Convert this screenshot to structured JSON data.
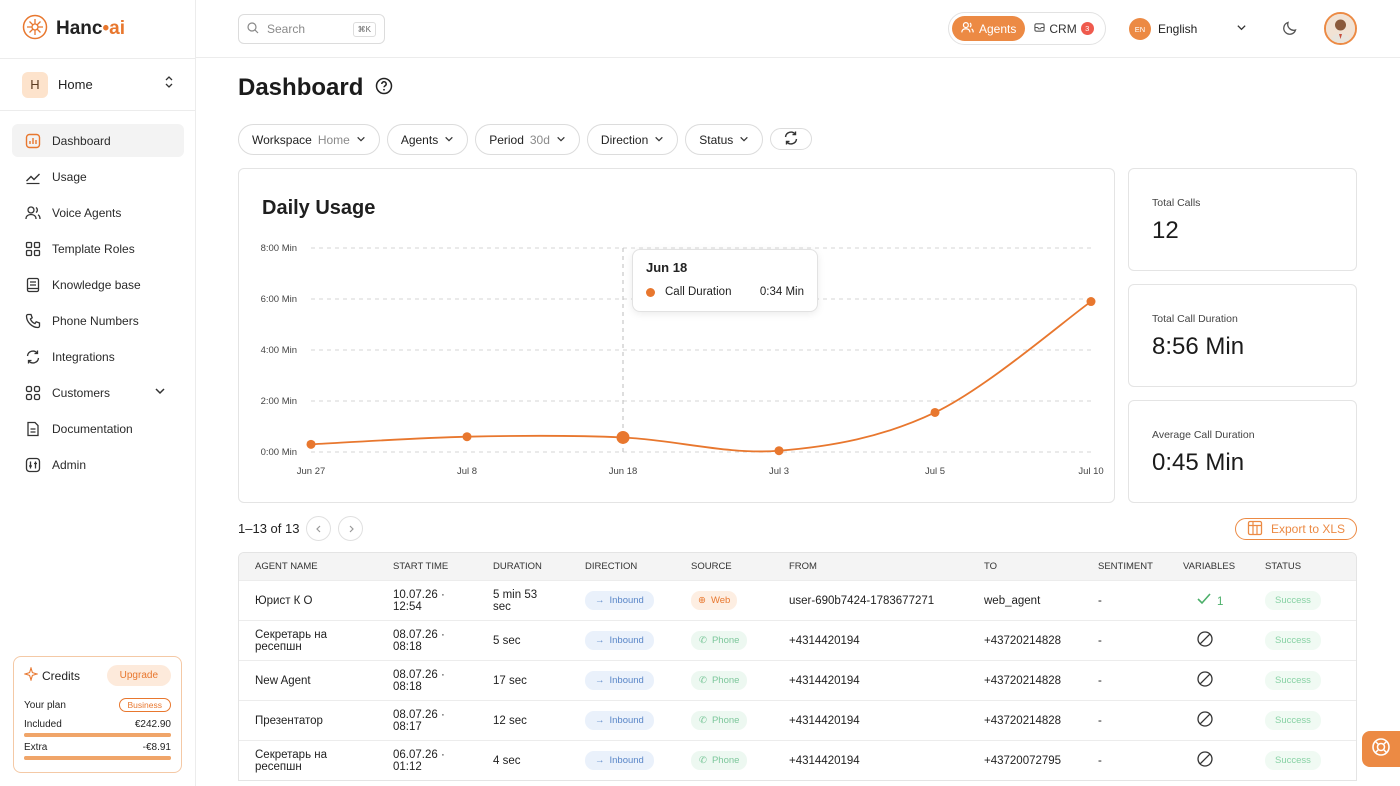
{
  "app": {
    "brand_a": "Hanc",
    "brand_dot": "•",
    "brand_b": "ai"
  },
  "workspace": {
    "initial": "H",
    "name": "Home"
  },
  "nav": [
    {
      "label": "Dashboard",
      "icon": "dashboard-icon",
      "active": true
    },
    {
      "label": "Usage",
      "icon": "trend-icon"
    },
    {
      "label": "Voice Agents",
      "icon": "users-icon"
    },
    {
      "label": "Template Roles",
      "icon": "grid-icon"
    },
    {
      "label": "Knowledge base",
      "icon": "book-icon"
    },
    {
      "label": "Phone Numbers",
      "icon": "phone-icon"
    },
    {
      "label": "Integrations",
      "icon": "sync-icon"
    },
    {
      "label": "Customers",
      "icon": "apps-icon"
    },
    {
      "label": "Documentation",
      "icon": "doc-icon"
    },
    {
      "label": "Admin",
      "icon": "admin-icon"
    }
  ],
  "credits": {
    "title": "Credits",
    "upgrade": "Upgrade",
    "plan_label": "Your plan",
    "plan": "Business",
    "included_label": "Included",
    "included": "€242.90",
    "included_fraction": 1.0,
    "extra_label": "Extra",
    "extra": "-€8.91",
    "extra_fraction": 1.0
  },
  "topbar": {
    "search_placeholder": "Search",
    "search_kbd": "⌘K",
    "agents": "Agents",
    "crm": "CRM",
    "crm_count": "3",
    "lang_code": "EN",
    "lang": "English"
  },
  "page": {
    "title": "Dashboard"
  },
  "filters": [
    {
      "label": "Workspace",
      "value": "Home"
    },
    {
      "label": "Agents",
      "value": ""
    },
    {
      "label": "Period",
      "value": "30d"
    },
    {
      "label": "Direction",
      "value": ""
    },
    {
      "label": "Status",
      "value": ""
    }
  ],
  "chart_data": {
    "type": "line",
    "title": "Daily Usage",
    "x": [
      "Jun 27",
      "Jul 8",
      "Jun 18",
      "Jul 3",
      "Jul 5",
      "Jul 10"
    ],
    "series": [
      {
        "name": "Call Duration",
        "values": [
          0.3,
          0.6,
          0.57,
          0.05,
          1.55,
          5.9
        ]
      }
    ],
    "y_ticks": [
      "0:00 Min",
      "2:00 Min",
      "4:00 Min",
      "6:00 Min",
      "8:00 Min"
    ],
    "ylim": [
      0,
      8
    ],
    "grid": true,
    "color": "#e8772e",
    "tooltip": {
      "date": "Jun 18",
      "series": "Call Duration",
      "value": "0:34 Min"
    }
  },
  "stats": [
    {
      "label": "Total Calls",
      "value": "12"
    },
    {
      "label": "Total Call Duration",
      "value": "8:56 Min"
    },
    {
      "label": "Average Call Duration",
      "value": "0:45 Min"
    }
  ],
  "pager": {
    "text": "1–13 of 13"
  },
  "export": "Export to XLS",
  "table": {
    "headers": [
      "Agent Name",
      "Start time",
      "Duration",
      "Direction",
      "Source",
      "From",
      "To",
      "Sentiment",
      "Variables",
      "Status"
    ],
    "rows": [
      {
        "agent": "Юрист К О",
        "start1": "10.07.26 ·",
        "start2": "12:54",
        "dur1": "5 min 53",
        "dur2": "sec",
        "direction": "Inbound",
        "source": "Web",
        "from": "user-690b7424-1783677271",
        "to": "web_agent",
        "sentiment": "-",
        "variables": "1",
        "status": "Success"
      },
      {
        "agent": "Секретарь на ресепшн",
        "start1": "08.07.26 ·",
        "start2": "08:18",
        "dur1": "5 sec",
        "dur2": "",
        "direction": "Inbound",
        "source": "Phone",
        "from": "+4314420194",
        "to": "+43720214828",
        "sentiment": "-",
        "variables": "",
        "status": "Success"
      },
      {
        "agent": "New Agent",
        "start1": "08.07.26 ·",
        "start2": "08:18",
        "dur1": "17 sec",
        "dur2": "",
        "direction": "Inbound",
        "source": "Phone",
        "from": "+4314420194",
        "to": "+43720214828",
        "sentiment": "-",
        "variables": "",
        "status": "Success"
      },
      {
        "agent": "Презентатор",
        "start1": "08.07.26 ·",
        "start2": "08:17",
        "dur1": "12 sec",
        "dur2": "",
        "direction": "Inbound",
        "source": "Phone",
        "from": "+4314420194",
        "to": "+43720214828",
        "sentiment": "-",
        "variables": "",
        "status": "Success"
      },
      {
        "agent": "Секретарь на ресепшн",
        "start1": "06.07.26 ·",
        "start2": "01:12",
        "dur1": "4 sec",
        "dur2": "",
        "direction": "Inbound",
        "source": "Phone",
        "from": "+4314420194",
        "to": "+43720072795",
        "sentiment": "-",
        "variables": "",
        "status": "Success"
      }
    ]
  }
}
